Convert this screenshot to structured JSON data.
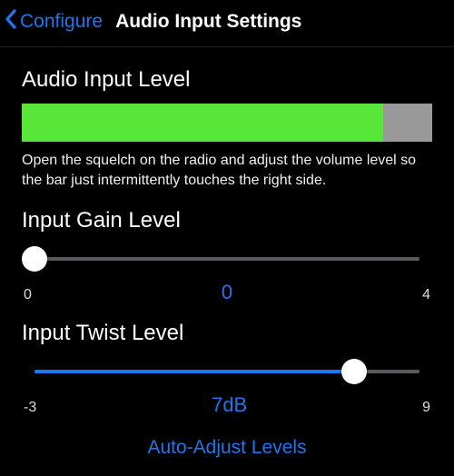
{
  "header": {
    "back_label": "Configure",
    "title": "Audio Input Settings"
  },
  "audio_level": {
    "label": "Audio Input Level",
    "percent": 88,
    "help": "Open the squelch on the radio and adjust the volume level so the bar just intermittently touches the right side."
  },
  "gain": {
    "label": "Input Gain Level",
    "min_label": "0",
    "max_label": "4",
    "value_label": "0",
    "percent": 0
  },
  "twist": {
    "label": "Input Twist Level",
    "min_label": "-3",
    "max_label": "9",
    "value_label": "7dB",
    "percent": 83
  },
  "auto_adjust_label": "Auto-Adjust Levels"
}
